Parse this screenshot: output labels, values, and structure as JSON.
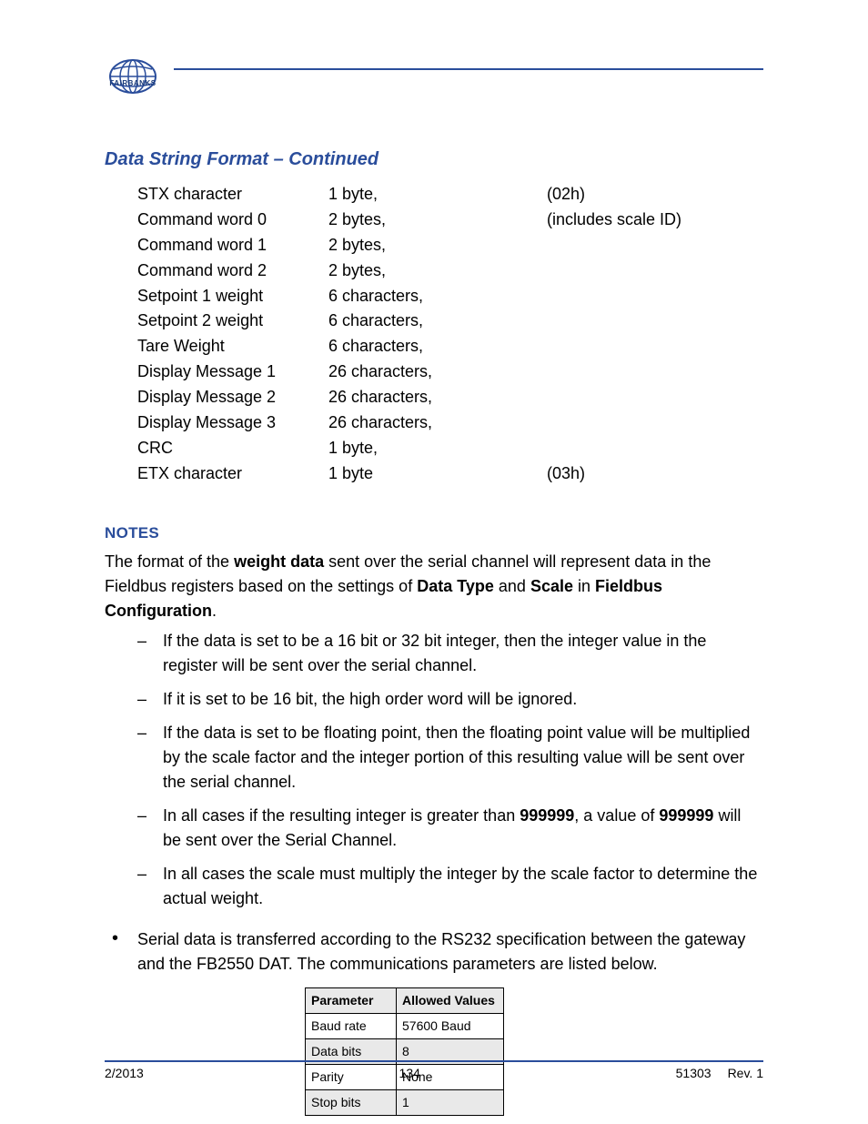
{
  "logo": {
    "brand": "FAIRBANKS"
  },
  "section_title": "Data String Format – Continued",
  "spec_rows": [
    {
      "c1": "STX character",
      "c2": "1 byte,",
      "c3": "(02h)"
    },
    {
      "c1": "Command word 0",
      "c2": "2 bytes,",
      "c3": "(includes scale ID)"
    },
    {
      "c1": "Command word 1",
      "c2": "2 bytes,",
      "c3": ""
    },
    {
      "c1": "Command word 2",
      "c2": "2 bytes,",
      "c3": ""
    },
    {
      "c1": "Setpoint  1 weight",
      "c2": "6 characters,",
      "c3": ""
    },
    {
      "c1": "Setpoint  2 weight",
      "c2": "6 characters,",
      "c3": ""
    },
    {
      "c1": "Tare Weight",
      "c2": "6 characters,",
      "c3": ""
    },
    {
      "c1": "Display Message 1",
      "c2": "26 characters,",
      "c3": ""
    },
    {
      "c1": "Display Message 2",
      "c2": "26 characters,",
      "c3": ""
    },
    {
      "c1": "Display Message 3",
      "c2": "26 characters,",
      "c3": ""
    },
    {
      "c1": "CRC",
      "c2": "1 byte,",
      "c3": ""
    },
    {
      "c1": "ETX character",
      "c2": "1 byte",
      "c3": "(03h)"
    }
  ],
  "subheading": "NOTES",
  "intro": {
    "t1": "The format of the ",
    "b1": "weight data",
    "t2": " sent over the serial channel will represent data in the Fieldbus registers based on the settings of ",
    "b2": "Data Type",
    "t3": " and ",
    "b3": "Scale",
    "t4": " in ",
    "b4": "Fieldbus Configuration",
    "t5": "."
  },
  "dash_items": {
    "d0": "If the data is set to be a 16 bit or 32 bit integer, then the integer value in the register will be sent over the serial channel.",
    "d1": "If it is set to be 16 bit, the high order word will be ignored.",
    "d2": "If the data is set to be floating point, then the floating point value will be multiplied by the scale factor and the integer portion of this resulting value will be sent over the serial channel.",
    "d3": {
      "p1": "In all cases if the resulting integer is greater than ",
      "b1": "999999",
      "p2": ", a value of ",
      "b2": "999999",
      "p3": " will be sent over the Serial Channel."
    },
    "d4": "In all cases the scale must multiply the integer by the scale factor to determine the actual weight."
  },
  "bullet_item": "Serial data is transferred according to the RS232 specification between the gateway and the FB2550 DAT. The communications parameters are listed below.",
  "params": {
    "headers": {
      "a": "Parameter",
      "b": "Allowed Values"
    },
    "rows": [
      {
        "a": "Baud rate",
        "b": "57600 Baud"
      },
      {
        "a": "Data bits",
        "b": "8"
      },
      {
        "a": "Parity",
        "b": "None"
      },
      {
        "a": "Stop bits",
        "b": "1"
      }
    ]
  },
  "footer": {
    "left": "2/2013",
    "center": "134",
    "doc": "51303",
    "rev": "Rev. 1"
  }
}
